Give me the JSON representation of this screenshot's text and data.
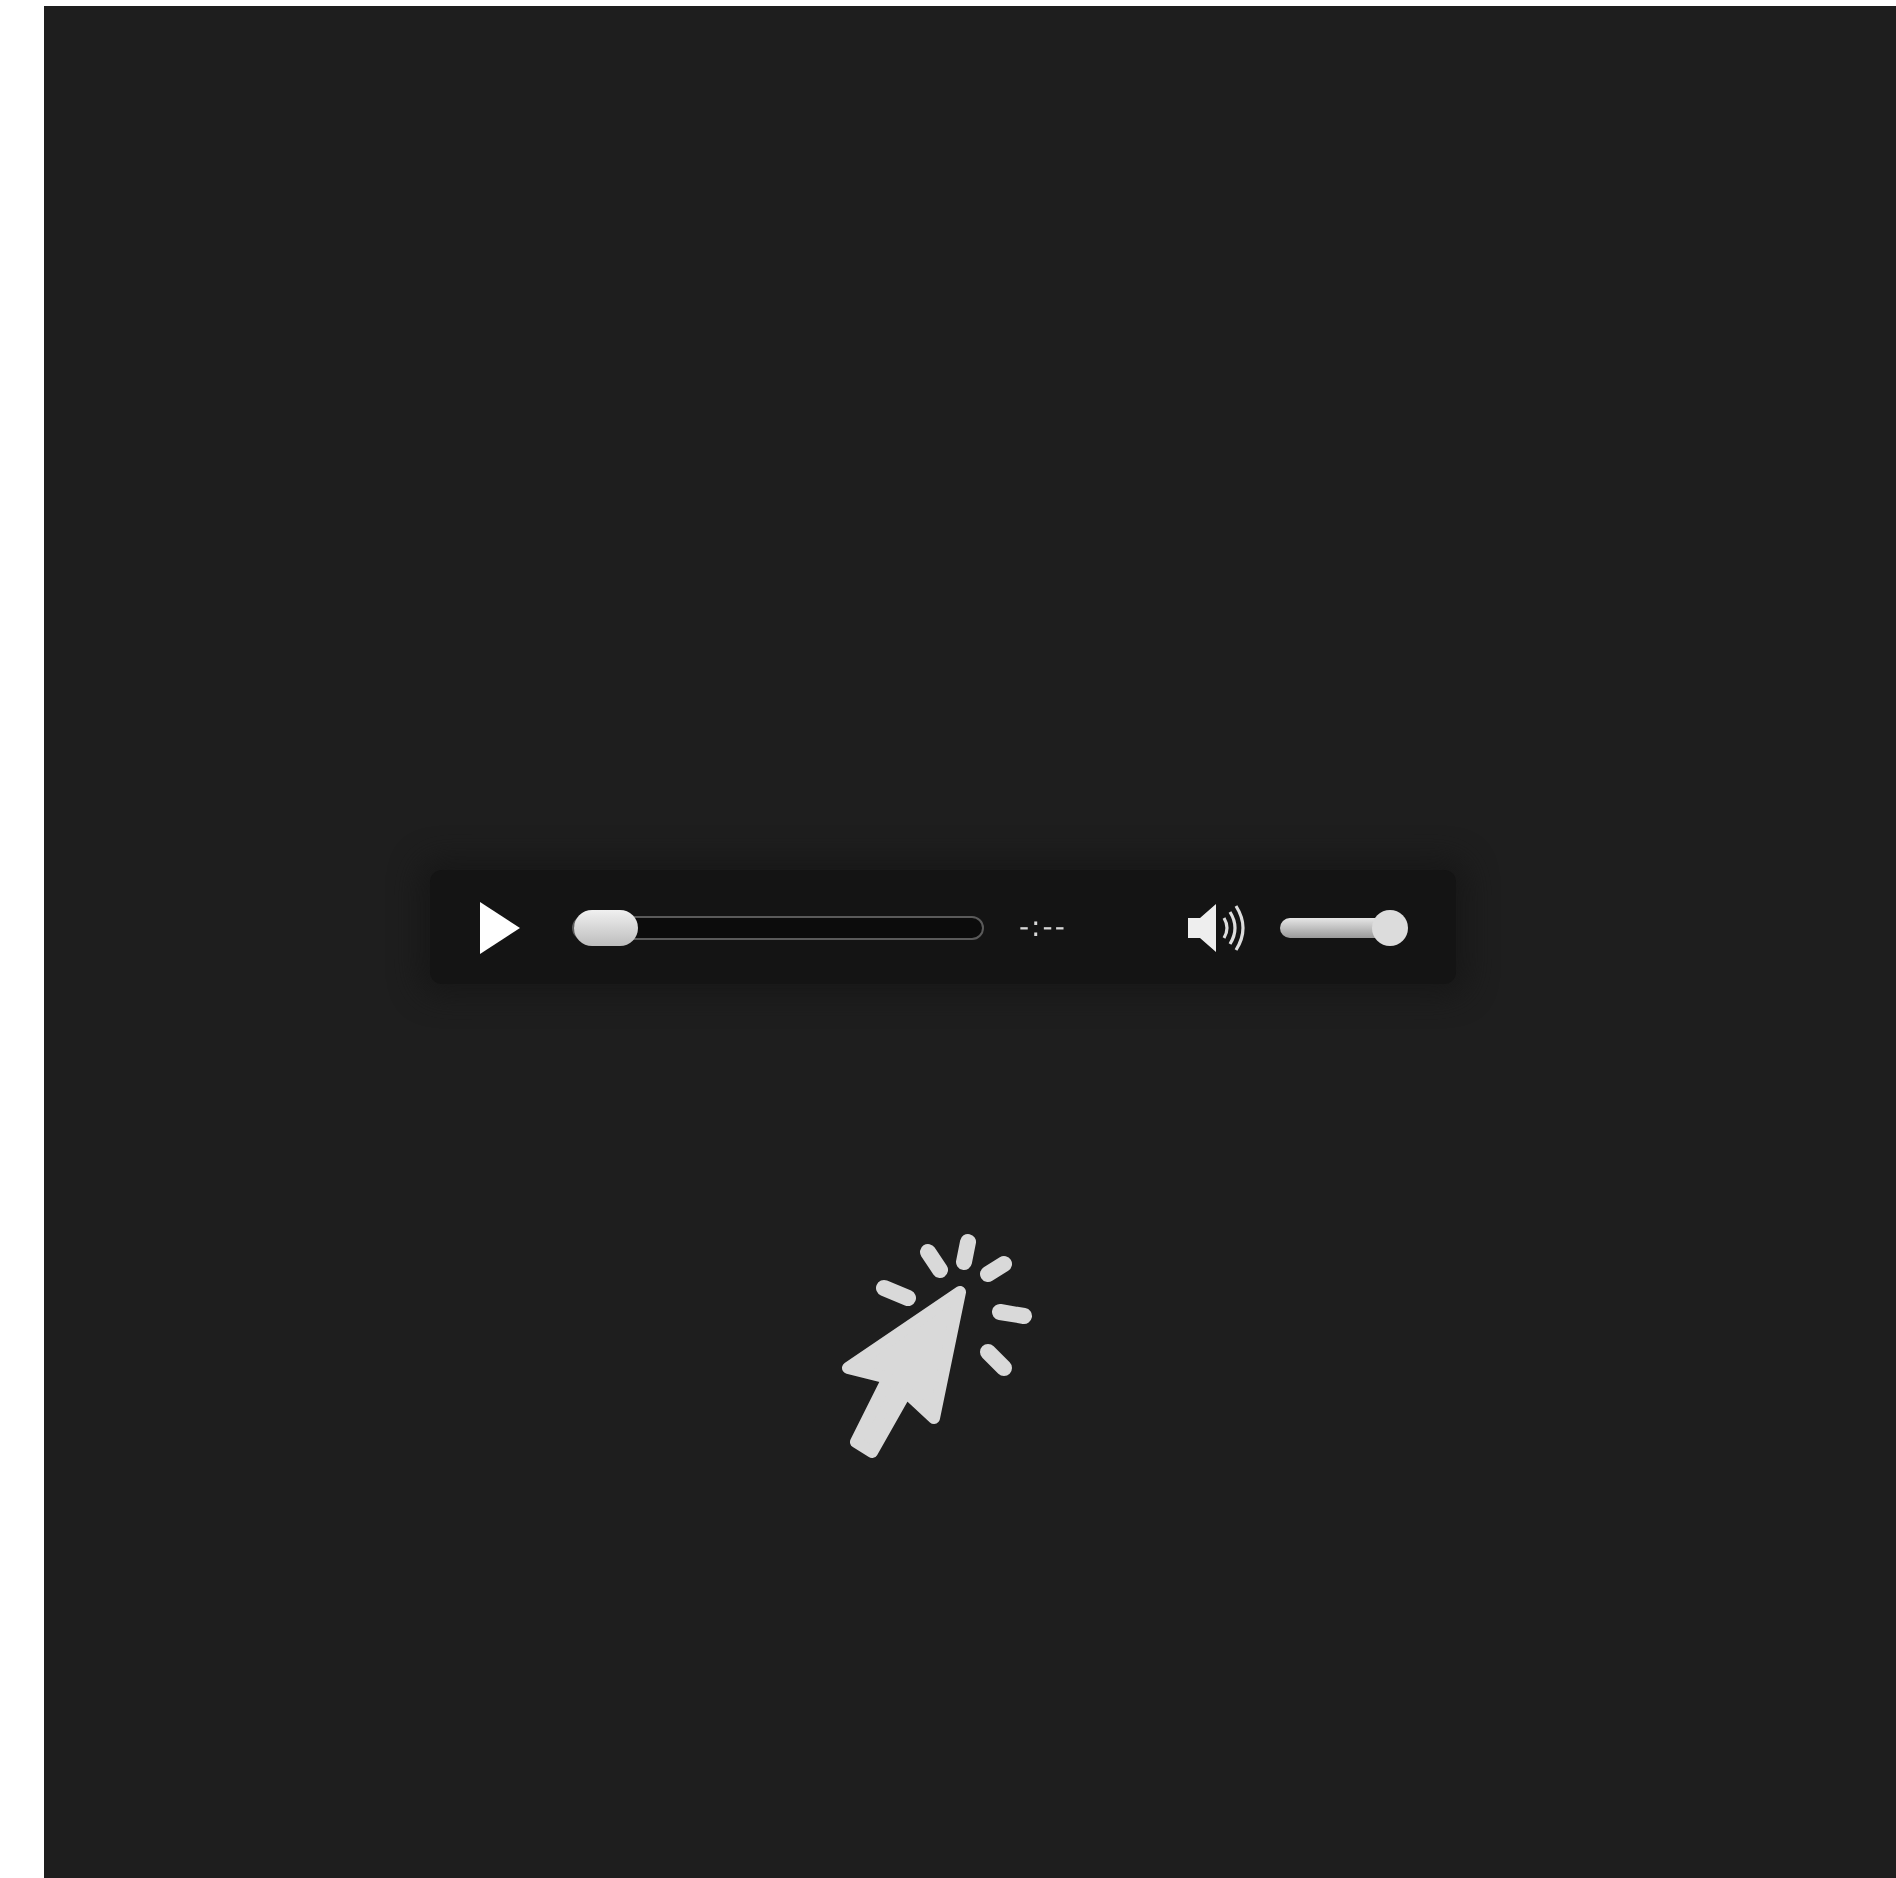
{
  "player": {
    "playing": false,
    "progress": {
      "level": 0
    },
    "time": "-:--",
    "volume": {
      "level": 1
    }
  }
}
